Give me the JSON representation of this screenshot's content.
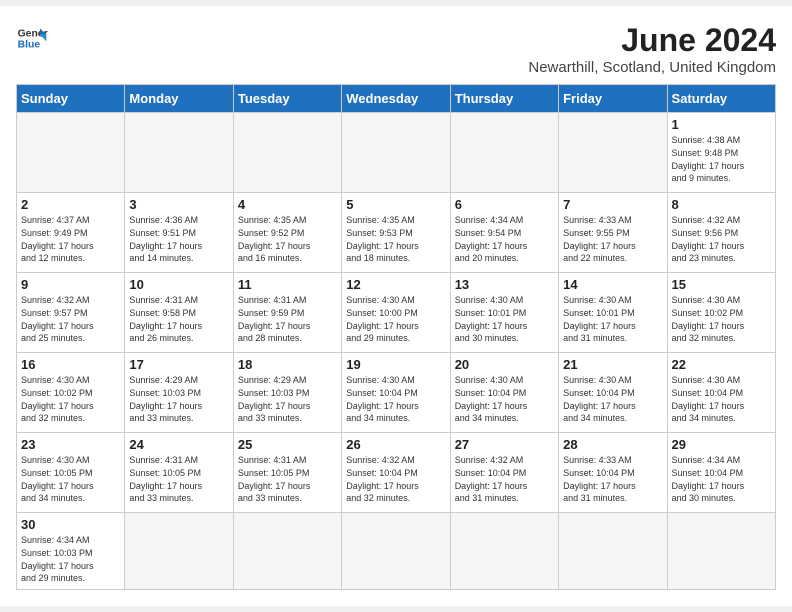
{
  "header": {
    "logo_line1": "General",
    "logo_line2": "Blue",
    "month_title": "June 2024",
    "subtitle": "Newarthill, Scotland, United Kingdom"
  },
  "weekdays": [
    "Sunday",
    "Monday",
    "Tuesday",
    "Wednesday",
    "Thursday",
    "Friday",
    "Saturday"
  ],
  "days": {
    "d1": {
      "num": "1",
      "info": "Sunrise: 4:38 AM\nSunset: 9:48 PM\nDaylight: 17 hours\nand 9 minutes."
    },
    "d2": {
      "num": "2",
      "info": "Sunrise: 4:37 AM\nSunset: 9:49 PM\nDaylight: 17 hours\nand 12 minutes."
    },
    "d3": {
      "num": "3",
      "info": "Sunrise: 4:36 AM\nSunset: 9:51 PM\nDaylight: 17 hours\nand 14 minutes."
    },
    "d4": {
      "num": "4",
      "info": "Sunrise: 4:35 AM\nSunset: 9:52 PM\nDaylight: 17 hours\nand 16 minutes."
    },
    "d5": {
      "num": "5",
      "info": "Sunrise: 4:35 AM\nSunset: 9:53 PM\nDaylight: 17 hours\nand 18 minutes."
    },
    "d6": {
      "num": "6",
      "info": "Sunrise: 4:34 AM\nSunset: 9:54 PM\nDaylight: 17 hours\nand 20 minutes."
    },
    "d7": {
      "num": "7",
      "info": "Sunrise: 4:33 AM\nSunset: 9:55 PM\nDaylight: 17 hours\nand 22 minutes."
    },
    "d8": {
      "num": "8",
      "info": "Sunrise: 4:32 AM\nSunset: 9:56 PM\nDaylight: 17 hours\nand 23 minutes."
    },
    "d9": {
      "num": "9",
      "info": "Sunrise: 4:32 AM\nSunset: 9:57 PM\nDaylight: 17 hours\nand 25 minutes."
    },
    "d10": {
      "num": "10",
      "info": "Sunrise: 4:31 AM\nSunset: 9:58 PM\nDaylight: 17 hours\nand 26 minutes."
    },
    "d11": {
      "num": "11",
      "info": "Sunrise: 4:31 AM\nSunset: 9:59 PM\nDaylight: 17 hours\nand 28 minutes."
    },
    "d12": {
      "num": "12",
      "info": "Sunrise: 4:30 AM\nSunset: 10:00 PM\nDaylight: 17 hours\nand 29 minutes."
    },
    "d13": {
      "num": "13",
      "info": "Sunrise: 4:30 AM\nSunset: 10:01 PM\nDaylight: 17 hours\nand 30 minutes."
    },
    "d14": {
      "num": "14",
      "info": "Sunrise: 4:30 AM\nSunset: 10:01 PM\nDaylight: 17 hours\nand 31 minutes."
    },
    "d15": {
      "num": "15",
      "info": "Sunrise: 4:30 AM\nSunset: 10:02 PM\nDaylight: 17 hours\nand 32 minutes."
    },
    "d16": {
      "num": "16",
      "info": "Sunrise: 4:30 AM\nSunset: 10:02 PM\nDaylight: 17 hours\nand 32 minutes."
    },
    "d17": {
      "num": "17",
      "info": "Sunrise: 4:29 AM\nSunset: 10:03 PM\nDaylight: 17 hours\nand 33 minutes."
    },
    "d18": {
      "num": "18",
      "info": "Sunrise: 4:29 AM\nSunset: 10:03 PM\nDaylight: 17 hours\nand 33 minutes."
    },
    "d19": {
      "num": "19",
      "info": "Sunrise: 4:30 AM\nSunset: 10:04 PM\nDaylight: 17 hours\nand 34 minutes."
    },
    "d20": {
      "num": "20",
      "info": "Sunrise: 4:30 AM\nSunset: 10:04 PM\nDaylight: 17 hours\nand 34 minutes."
    },
    "d21": {
      "num": "21",
      "info": "Sunrise: 4:30 AM\nSunset: 10:04 PM\nDaylight: 17 hours\nand 34 minutes."
    },
    "d22": {
      "num": "22",
      "info": "Sunrise: 4:30 AM\nSunset: 10:04 PM\nDaylight: 17 hours\nand 34 minutes."
    },
    "d23": {
      "num": "23",
      "info": "Sunrise: 4:30 AM\nSunset: 10:05 PM\nDaylight: 17 hours\nand 34 minutes."
    },
    "d24": {
      "num": "24",
      "info": "Sunrise: 4:31 AM\nSunset: 10:05 PM\nDaylight: 17 hours\nand 33 minutes."
    },
    "d25": {
      "num": "25",
      "info": "Sunrise: 4:31 AM\nSunset: 10:05 PM\nDaylight: 17 hours\nand 33 minutes."
    },
    "d26": {
      "num": "26",
      "info": "Sunrise: 4:32 AM\nSunset: 10:04 PM\nDaylight: 17 hours\nand 32 minutes."
    },
    "d27": {
      "num": "27",
      "info": "Sunrise: 4:32 AM\nSunset: 10:04 PM\nDaylight: 17 hours\nand 31 minutes."
    },
    "d28": {
      "num": "28",
      "info": "Sunrise: 4:33 AM\nSunset: 10:04 PM\nDaylight: 17 hours\nand 31 minutes."
    },
    "d29": {
      "num": "29",
      "info": "Sunrise: 4:34 AM\nSunset: 10:04 PM\nDaylight: 17 hours\nand 30 minutes."
    },
    "d30": {
      "num": "30",
      "info": "Sunrise: 4:34 AM\nSunset: 10:03 PM\nDaylight: 17 hours\nand 29 minutes."
    }
  }
}
